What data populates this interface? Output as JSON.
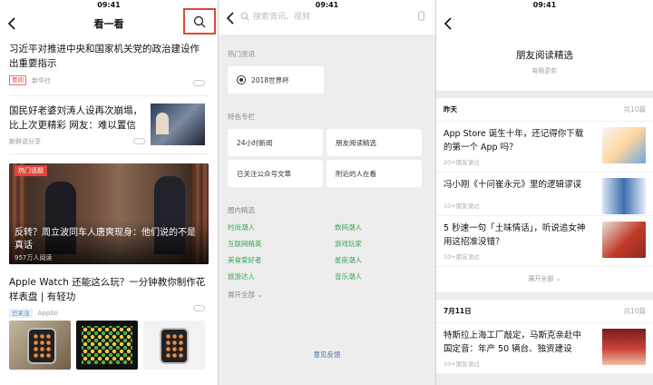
{
  "status_time": "09:41",
  "screen1": {
    "title": "看一看",
    "articles": [
      {
        "title": "习近平对推进中央和国家机关党的政治建设作出重要指示",
        "tag": "要闻",
        "source": "新华社"
      },
      {
        "title": "国民好老婆刘涛人设再次崩塌，比上次更精彩 网友：难以置信",
        "source": "新鲜说分享"
      },
      {
        "tag": "热门话题",
        "title": "反转？周立波同车人唐爽现身：他们说的不是真话",
        "views": "957万人阅读"
      },
      {
        "title": "Apple Watch 还能这么玩？一分钟教你制作花样表盘 | 有轻功",
        "tag": "已关注",
        "source": "AppSo"
      }
    ]
  },
  "screen2": {
    "search_placeholder": "搜索资讯、视频",
    "hot_label": "热门资讯",
    "hot_item": "2018世界杯",
    "special_label": "特色专栏",
    "special_items": [
      "24小时新闻",
      "朋友阅读精选",
      "已关注公众号文章",
      "附近的人在看"
    ],
    "circle_label": "圈内精选",
    "circle_items": [
      "时尚潮人",
      "数码潮人",
      "互联网精英",
      "游戏玩家",
      "美食爱好者",
      "星座潮人",
      "旅游达人",
      "音乐潮人"
    ],
    "expand_all": "展开全部",
    "feedback": "意见反馈"
  },
  "screen3": {
    "header_title": "朋友阅读精选",
    "header_sub": "每晚更新",
    "groups": [
      {
        "date": "昨天",
        "count": "共10篇",
        "items": [
          {
            "title": "App Store 诞生十年，还记得你下载的第一个 App 吗？",
            "meta": "20+朋友读过"
          },
          {
            "title": "冯小刚《十问崔永元》里的逻辑谬误",
            "meta": "10+朋友读过"
          },
          {
            "title": "5 秒速一句「土味情话」，听说追女神用这招准没错？",
            "meta": "10+朋友读过"
          }
        ],
        "show_all": "展开全部"
      },
      {
        "date": "7月11日",
        "count": "共10篇",
        "items": [
          {
            "title": "特斯拉上海工厂敲定，马斯克亲赴中国定音：年产 50 辆台、独资建设",
            "meta": "10+朋友读过"
          }
        ]
      }
    ]
  },
  "colors": {
    "accent_red": "#e0463c",
    "green": "#3aa757",
    "link_blue": "#4a6fa5"
  }
}
